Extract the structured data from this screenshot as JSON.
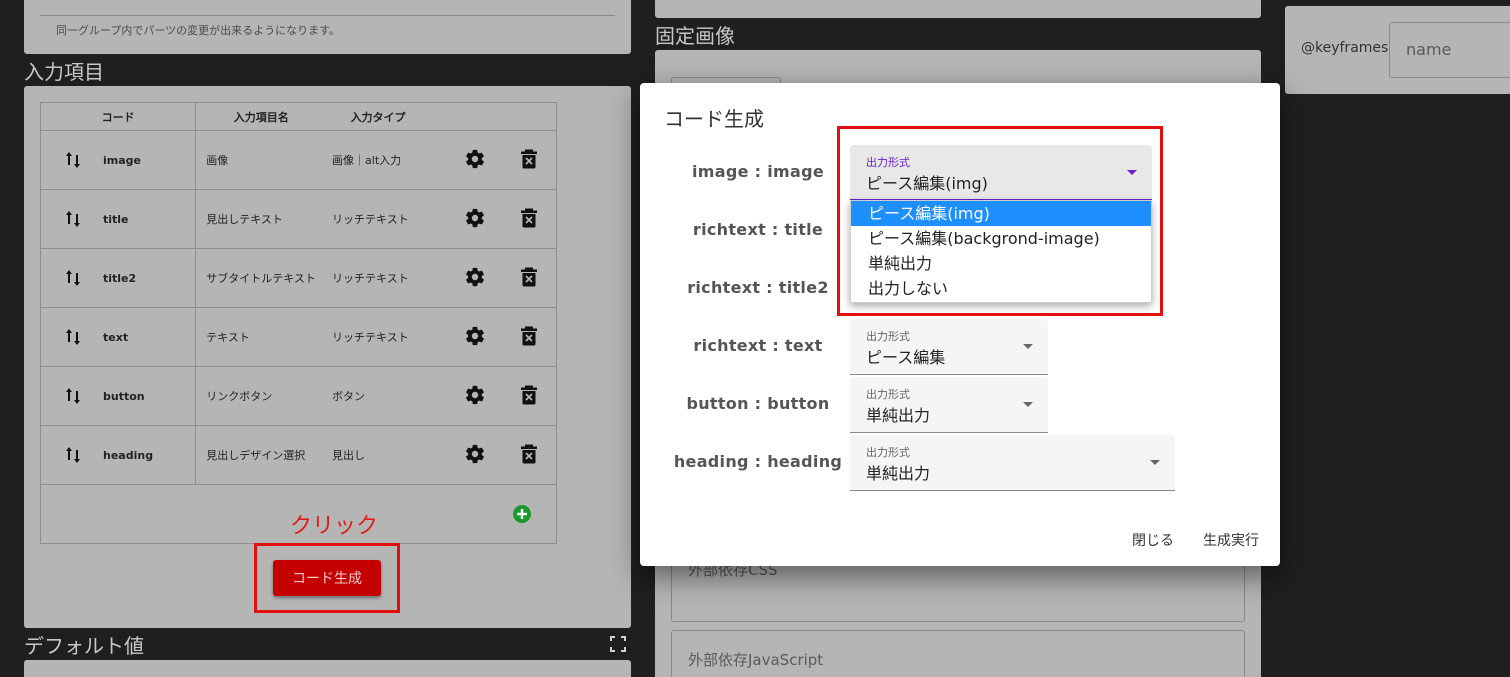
{
  "background": {
    "top_hint": "同一グループ内でパーツの変更が出来るようになります。",
    "input_section_title": "入力項目",
    "fixed_image_title": "固定画像",
    "default_title": "デフォルト値",
    "table_headers": {
      "code": "コード",
      "name": "入力項目名",
      "type": "入力タイプ"
    },
    "rows": [
      {
        "code": "image",
        "name": "画像",
        "type": "画像｜alt入力"
      },
      {
        "code": "title",
        "name": "見出しテキスト",
        "type": "リッチテキスト"
      },
      {
        "code": "title2",
        "name": "サブタイトルテキスト",
        "type": "リッチテキスト"
      },
      {
        "code": "text",
        "name": "テキスト",
        "type": "リッチテキスト"
      },
      {
        "code": "button",
        "name": "リンクボタン",
        "type": "ボタン"
      },
      {
        "code": "heading",
        "name": "見出しデザイン選択",
        "type": "見出し"
      }
    ],
    "click_annotation": "クリック",
    "generate_button": "コード生成",
    "external_css": "外部依存CSS",
    "external_js": "外部依存JavaScript",
    "keyframes_label": "@keyframes",
    "keyframes_placeholder": "name"
  },
  "dialog": {
    "title": "コード生成",
    "select_caption": "出力形式",
    "rows": [
      {
        "label": "image : image",
        "value": "ピース編集(img)"
      },
      {
        "label": "richtext : title",
        "value": ""
      },
      {
        "label": "richtext : title2",
        "value": ""
      },
      {
        "label": "richtext : text",
        "value": "ピース編集"
      },
      {
        "label": "button : button",
        "value": "単純出力"
      },
      {
        "label": "heading : heading",
        "value": "単純出力"
      }
    ],
    "menu_options": [
      "ピース編集(img)",
      "ピース編集(backgrond-image)",
      "単純出力",
      "出力しない"
    ],
    "close_label": "閉じる",
    "execute_label": "生成実行"
  },
  "colors": {
    "accent": "#6a1fd1",
    "highlight": "#1e8fff",
    "annotation_red": "#e01010",
    "button_red": "#c40000"
  }
}
